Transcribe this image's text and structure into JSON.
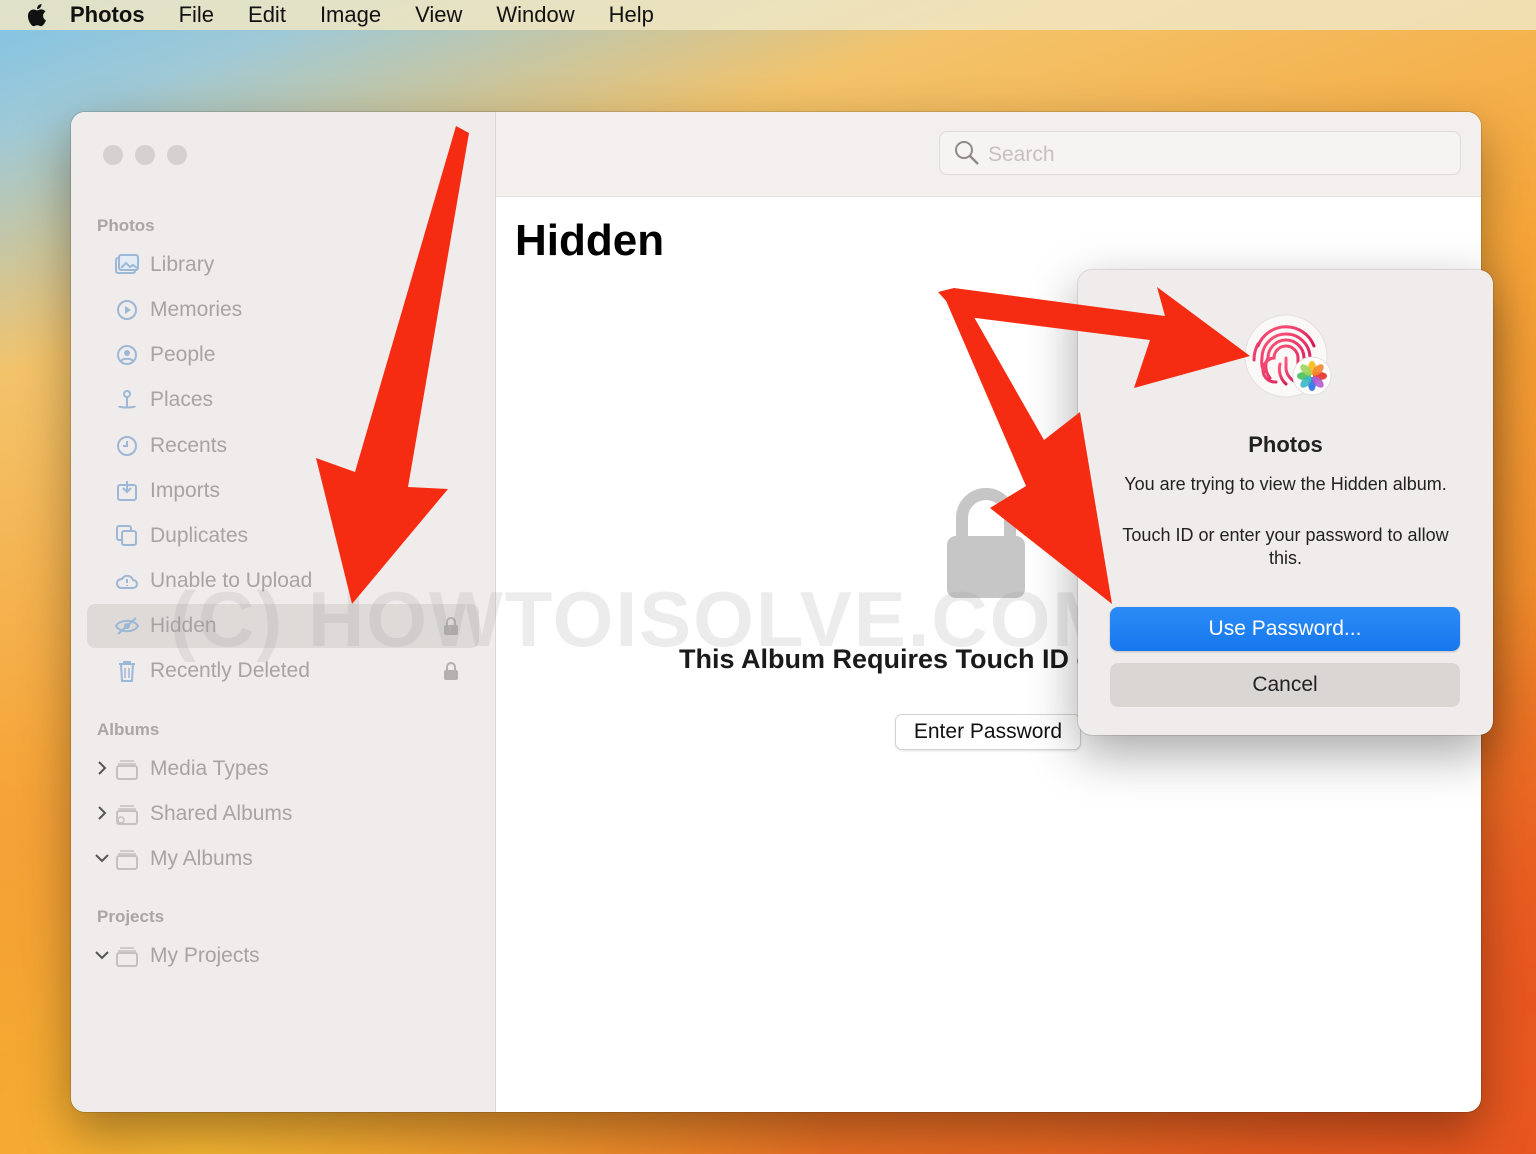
{
  "menubar": {
    "items": [
      "Photos",
      "File",
      "Edit",
      "Image",
      "View",
      "Window",
      "Help"
    ]
  },
  "toolbar": {
    "search_placeholder": "Search"
  },
  "sidebar": {
    "sections": {
      "photos": "Photos",
      "albums": "Albums",
      "projects": "Projects"
    },
    "items": [
      {
        "label": "Library",
        "icon": "library-icon"
      },
      {
        "label": "Memories",
        "icon": "memories-icon"
      },
      {
        "label": "People",
        "icon": "people-icon"
      },
      {
        "label": "Places",
        "icon": "places-icon"
      },
      {
        "label": "Recents",
        "icon": "recents-icon"
      },
      {
        "label": "Imports",
        "icon": "imports-icon"
      },
      {
        "label": "Duplicates",
        "icon": "duplicates-icon"
      },
      {
        "label": "Unable to Upload",
        "icon": "cloud-warning-icon"
      },
      {
        "label": "Hidden",
        "icon": "hidden-eye-icon",
        "selected": true,
        "locked": true
      },
      {
        "label": "Recently Deleted",
        "icon": "trash-icon",
        "locked": true
      }
    ],
    "album_items": [
      {
        "label": "Media Types",
        "icon": "album-stack-icon"
      },
      {
        "label": "Shared Albums",
        "icon": "shared-albums-icon"
      },
      {
        "label": "My Albums",
        "icon": "album-stack-icon"
      }
    ],
    "project_items": [
      {
        "label": "My Projects",
        "icon": "album-stack-icon"
      }
    ]
  },
  "main": {
    "title": "Hidden",
    "lock_message": "This Album Requires Touch ID c",
    "enter_password_label": "Enter Password"
  },
  "watermark": "(C) HOWTOISOLVE.COM",
  "dialog": {
    "app_name": "Photos",
    "message": "You are trying to view the Hidden album.",
    "detail": "Touch ID or enter your password to allow this.",
    "primary_button": "Use Password...",
    "cancel_button": "Cancel"
  },
  "colors": {
    "accent_blue": "#1677ee",
    "annotation_red": "#f52b12"
  }
}
